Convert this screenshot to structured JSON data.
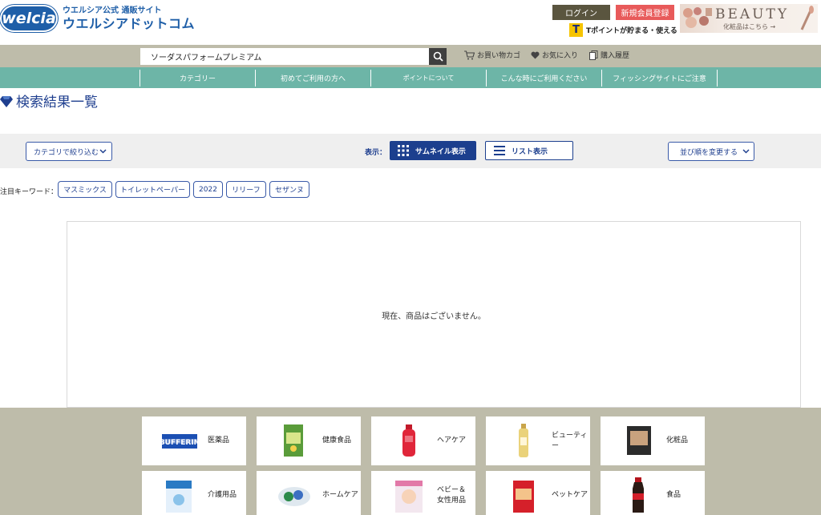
{
  "header": {
    "logo_badge": "welcia",
    "logo_sub": "ウエルシア公式 通販サイト",
    "logo_main": "ウエルシアドットコム",
    "login_label": "ログイン",
    "register_label": "新規会員登録",
    "tpoint_icon": "T",
    "tpoint_text": "Tポイントが貯まる・使える",
    "beauty_title": "BEAUTY",
    "beauty_sub": "化粧品はこちら →"
  },
  "search": {
    "value": "ソーダスパフォームプレミアム",
    "cart_label": "お買い物カゴ",
    "favorites_label": "お気に入り",
    "history_label": "購入履歴"
  },
  "nav": {
    "items": [
      {
        "label": "カテゴリー"
      },
      {
        "label": "初めてご利用の方へ"
      },
      {
        "label": "ポイントについて"
      },
      {
        "label": "こんな時にご利用ください"
      },
      {
        "label": "フィッシングサイトにご注意"
      }
    ]
  },
  "page": {
    "title": "検索結果一覧"
  },
  "toolbar": {
    "category_filter": "カテゴリで絞り込む",
    "view_label": "表示：",
    "thumbnail_label": "サムネイル表示",
    "list_label": "リスト表示",
    "sort_label": "並び順を変更する"
  },
  "keywords": {
    "label": "注目キーワード：",
    "items": [
      "マスミックス",
      "トイレットペーパー",
      "2022",
      "リリーフ",
      "セザンヌ"
    ]
  },
  "results": {
    "empty_message": "現在、商品はございません。"
  },
  "categories": [
    {
      "label": "医薬品",
      "icon": "medicine-icon"
    },
    {
      "label": "健康食品",
      "icon": "health-food-icon"
    },
    {
      "label": "ヘアケア",
      "icon": "haircare-icon"
    },
    {
      "label": "ビューティー",
      "icon": "beauty-icon"
    },
    {
      "label": "化粧品",
      "icon": "cosmetics-icon"
    },
    {
      "label": "介護用品",
      "icon": "nursing-care-icon"
    },
    {
      "label": "ホームケア",
      "icon": "home-care-icon"
    },
    {
      "label": "ベビー＆\n女性用品",
      "icon": "baby-icon"
    },
    {
      "label": "ペットケア",
      "icon": "pet-care-icon"
    },
    {
      "label": "食品",
      "icon": "food-icon"
    }
  ],
  "colors": {
    "brand_blue": "#1f5fa8",
    "nav_green": "#6db5a7",
    "footer_khaki": "#bebcaa",
    "login_bg": "#5a553f",
    "register_bg": "#e85a5a",
    "button_navy": "#1c3f8e"
  }
}
